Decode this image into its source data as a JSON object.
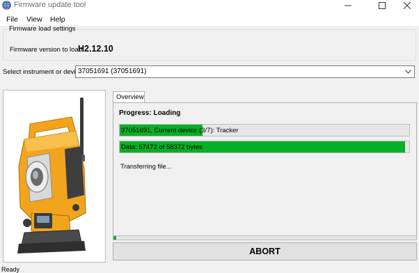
{
  "window": {
    "title": "Firmware update tool",
    "icon": "globe-app-icon",
    "controls": [
      "minimize-icon",
      "maximize-icon",
      "close-icon"
    ]
  },
  "menu": {
    "items": [
      "File",
      "View",
      "Help"
    ]
  },
  "firmware_settings": {
    "group_title": "Firmware load settings",
    "version_label": "Firmware version to load:",
    "version_value": "H2.12.10"
  },
  "device_select": {
    "label": "Select instrument or device",
    "value": "37051691 (37051691)"
  },
  "tabs": [
    {
      "label": "Overview",
      "selected": true
    }
  ],
  "progress": {
    "title": "Progress: Loading",
    "device_bar": {
      "text": "37051691, Current device (3/7): Tracker",
      "fraction": 0.285
    },
    "data_bar": {
      "text": "Data: 57472 of 58372 bytes",
      "fraction": 0.985
    },
    "message": "Transferring file...",
    "overall_fraction": 0.01
  },
  "abort_button": {
    "label": "ABORT"
  },
  "status_bar": {
    "text": "Ready"
  },
  "colors": {
    "progress_fill": "#06b025",
    "instrument_body": "#f2a51c",
    "window_bg": "#f0f0f0"
  }
}
